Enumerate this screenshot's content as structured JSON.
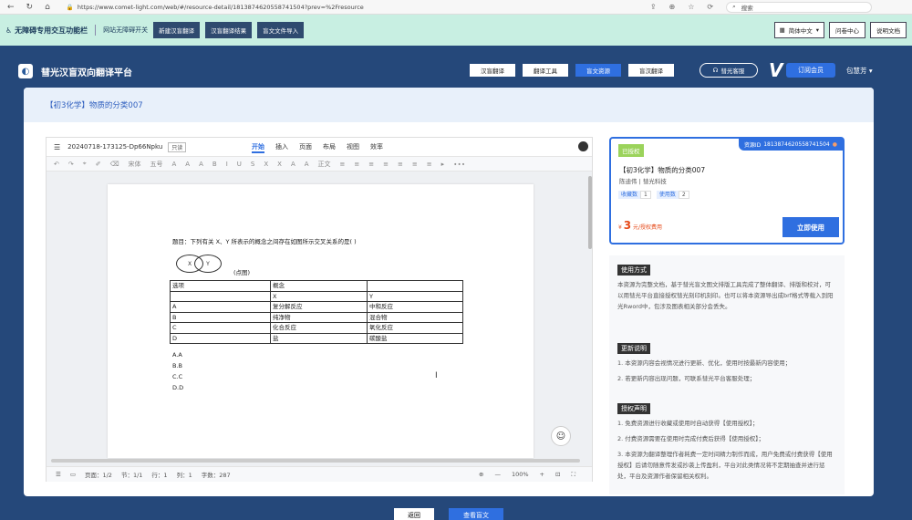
{
  "browser": {
    "url": "https://www.comet-light.com/web/#/resource-detail/1813874620558741504?prev=%2Fresource",
    "search_placeholder": "搜索"
  },
  "accessibility_bar": {
    "title": "无障碍专用交互功能栏",
    "toggle_label": "网站无障碍开关",
    "buttons": [
      "新建汉盲翻译",
      "汉盲翻译结果",
      "盲文文件导入"
    ],
    "language": "简体中文",
    "right_buttons": [
      "问卷中心",
      "说明文档"
    ]
  },
  "header": {
    "app_title": "彗光汉盲双向翻译平台",
    "nav": [
      {
        "label": "汉盲翻译",
        "active": false
      },
      {
        "label": "翻译工具",
        "active": false
      },
      {
        "label": "盲文资源",
        "active": true
      },
      {
        "label": "盲汉翻译",
        "active": false
      }
    ],
    "service": "彗光客服",
    "member": "订阅会员",
    "user": "包慧芳"
  },
  "breadcrumb": "【初3化学】物质的分类007",
  "editor": {
    "file_name": "20240718-173125-Dp66Npku",
    "badge": "只读",
    "tabs": [
      "开始",
      "插入",
      "页面",
      "布局",
      "视图",
      "效率"
    ],
    "active_tab": "开始",
    "toolbar": [
      "↶",
      "↷",
      "⌖",
      "✐",
      "⌫",
      "宋体",
      "五号",
      "A",
      "A",
      "A",
      "B",
      "I",
      "U",
      "S",
      "X",
      "X",
      "A",
      "A",
      "正文",
      "≡",
      "≡",
      "≡",
      "≡",
      "≡",
      "≡",
      "≡",
      "▸",
      "∙∙∙"
    ],
    "doc": {
      "question": "题目：下列有关 X、Y 所表示的概念之间存在如图所示交叉关系的是( )",
      "venn_x": "X",
      "venn_y": "Y",
      "pic_note": "(点图)",
      "table": {
        "header": [
          "选项",
          "概念",
          ""
        ],
        "sub": [
          "",
          "X",
          "Y"
        ],
        "rows": [
          [
            "A",
            "复分解反应",
            "中和反应"
          ],
          [
            "B",
            "纯净物",
            "混合物"
          ],
          [
            "C",
            "化合反应",
            "氧化反应"
          ],
          [
            "D",
            "盐",
            "碳酸盐"
          ]
        ]
      },
      "options": [
        "A.A",
        "B.B",
        "C.C",
        "D.D"
      ]
    },
    "status": {
      "page": "页面：1/2",
      "section": "节：1/1",
      "row": "行：1",
      "col": "列：1",
      "words": "字数：287",
      "zoom": "100%"
    }
  },
  "resource": {
    "tag": "已授权",
    "id_label": "资源ID",
    "id": "1813874620558741504",
    "title": "【初3化学】物质的分类007",
    "author": "陈迪伟 | 彗光科技",
    "stats": [
      {
        "label": "收藏数",
        "value": "1"
      },
      {
        "label": "使用数",
        "value": "2"
      }
    ],
    "price_symbol": "¥",
    "price": "3",
    "price_unit": "元/授权费用",
    "use_button": "立即使用"
  },
  "info": {
    "usage_title": "使用方式",
    "usage_text": "本资源为完整文档，基于彗光盲文图文排版工具完成了整体翻译、排版和校对，可以用彗光平台直接授权彗光刻印机刻印。也可以将本资源导出成brf格式等载入到阳光Rword中，包涉及图表相关部分会丢失。",
    "update_title": "更新说明",
    "update_items": [
      "1. 本资源内容会视情况进行更新、优化，使用时按最新内容使用；",
      "2. 若更新内容出现问题，可联系彗光平台客服处理；"
    ],
    "license_title": "授权声明",
    "license_items": [
      "1. 免费资源进行收藏或使用时自动获得【使用授权】；",
      "2. 付费资源需要在使用时完成付费后获得【使用授权】；",
      "3. 本资源为翻译整理作者耗费一定时间精力制作而成，用户免费或付费获得【使用授权】后请勿随意传发或抄袭上传盈利，平台对此类情况将不定期抽查并进行惩处，平台及资源作者保留相关权利。"
    ]
  },
  "bottom": {
    "back": "返回",
    "view": "查看盲文"
  },
  "colors": {
    "brand": "#25487a",
    "accent": "#2f6fe0",
    "accessibility_bg": "#c8efe2"
  }
}
